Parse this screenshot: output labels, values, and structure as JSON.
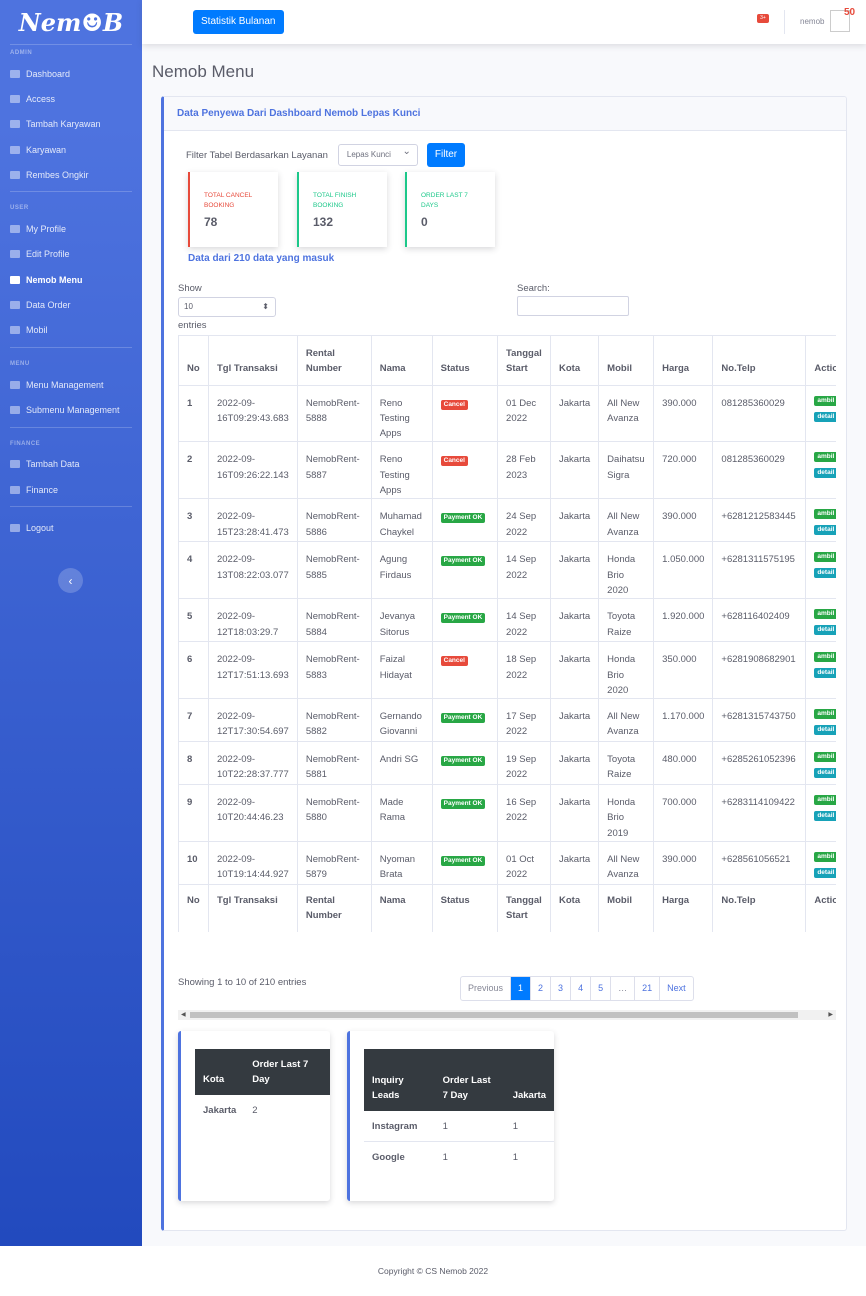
{
  "brand": "Nem☻B",
  "sidebar": {
    "sections": [
      {
        "heading": "ADMIN",
        "items": [
          {
            "label": "Dashboard",
            "icon": "dashboard-icon"
          },
          {
            "label": "Access",
            "icon": "users-icon"
          },
          {
            "label": "Tambah Karyawan",
            "icon": "user-plus-icon"
          },
          {
            "label": "Karyawan",
            "icon": "users-icon"
          },
          {
            "label": "Rembes Ongkir",
            "icon": "file-icon"
          }
        ]
      },
      {
        "heading": "USER",
        "items": [
          {
            "label": "My Profile",
            "icon": "user-icon"
          },
          {
            "label": "Edit Profile",
            "icon": "user-edit-icon"
          },
          {
            "label": "Nemob Menu",
            "icon": "sitemap-icon",
            "active": true
          },
          {
            "label": "Data Order",
            "icon": "chart-icon"
          },
          {
            "label": "Mobil",
            "icon": "car-icon"
          }
        ]
      },
      {
        "heading": "MENU",
        "items": [
          {
            "label": "Menu Management",
            "icon": "folder-icon"
          },
          {
            "label": "Submenu Management",
            "icon": "folder-open-icon"
          }
        ]
      },
      {
        "heading": "FINANCE",
        "items": [
          {
            "label": "Tambah Data",
            "icon": "file-icon"
          },
          {
            "label": "Finance",
            "icon": "money-icon"
          }
        ]
      }
    ],
    "logout": "Logout",
    "toggle": "‹"
  },
  "topbar": {
    "stat_button": "Statistik Bulanan",
    "alert_count": "3+",
    "username": "nemob",
    "badge": "50"
  },
  "page_title": "Nemob Menu",
  "card": {
    "header": "Data Penyewa Dari Dashboard Nemob Lepas Kunci",
    "filter_label": "Filter Tabel Berdasarkan Layanan",
    "filter_value": "Lepas Kunci",
    "filter_button": "Filter",
    "stats": [
      {
        "label": "TOTAL CANCEL BOOKING",
        "value": "78",
        "color": "#e74a3b"
      },
      {
        "label": "TOTAL FINISH BOOKING",
        "value": "132",
        "color": "#1cc88a"
      },
      {
        "label": "ORDER LAST 7 DAYS",
        "value": "0",
        "color": "#1cc88a"
      }
    ],
    "data_note": "Data dari 210 data yang masuk"
  },
  "table": {
    "show_label": "Show",
    "show_value": "10",
    "entries_label": "entries",
    "search_label": "Search:",
    "columns": [
      "No",
      "Tgl Transaksi",
      "Rental Number",
      "Nama",
      "Status",
      "Tanggal Start",
      "Kota",
      "Mobil",
      "Harga",
      "No.Telp",
      "Action"
    ],
    "rows": [
      {
        "no": "1",
        "tgl": "2022-09-16T09:29:43.683",
        "rental": "NemobRent-5888",
        "nama": "Reno Testing Apps",
        "status": "Cancel",
        "start": "01 Dec 2022",
        "kota": "Jakarta",
        "mobil": "All New Avanza",
        "harga": "390.000",
        "telp": "081285360029",
        "ambil": "ambil",
        "detail": "detail"
      },
      {
        "no": "2",
        "tgl": "2022-09-16T09:26:22.143",
        "rental": "NemobRent-5887",
        "nama": "Reno Testing Apps",
        "status": "Cancel",
        "start": "28 Feb 2023",
        "kota": "Jakarta",
        "mobil": "Daihatsu Sigra",
        "harga": "720.000",
        "telp": "081285360029",
        "ambil": "ambil",
        "detail": "detail"
      },
      {
        "no": "3",
        "tgl": "2022-09-15T23:28:41.473",
        "rental": "NemobRent-5886",
        "nama": "Muhamad Chaykel",
        "status": "Payment OK",
        "start": "24 Sep 2022",
        "kota": "Jakarta",
        "mobil": "All New Avanza",
        "harga": "390.000",
        "telp": "+6281212583445",
        "ambil": "ambil",
        "detail": "detail"
      },
      {
        "no": "4",
        "tgl": "2022-09-13T08:22:03.077",
        "rental": "NemobRent-5885",
        "nama": "Agung Firdaus",
        "status": "Payment OK",
        "start": "14 Sep 2022",
        "kota": "Jakarta",
        "mobil": "Honda Brio 2020",
        "harga": "1.050.000",
        "telp": "+6281311575195",
        "ambil": "ambil",
        "detail": "detail"
      },
      {
        "no": "5",
        "tgl": "2022-09-12T18:03:29.7",
        "rental": "NemobRent-5884",
        "nama": "Jevanya Sitorus",
        "status": "Payment OK",
        "start": "14 Sep 2022",
        "kota": "Jakarta",
        "mobil": "Toyota Raize",
        "harga": "1.920.000",
        "telp": "+628116402409",
        "ambil": "ambil",
        "detail": "detail"
      },
      {
        "no": "6",
        "tgl": "2022-09-12T17:51:13.693",
        "rental": "NemobRent-5883",
        "nama": "Faizal Hidayat",
        "status": "Cancel",
        "start": "18 Sep 2022",
        "kota": "Jakarta",
        "mobil": "Honda Brio 2020",
        "harga": "350.000",
        "telp": "+6281908682901",
        "ambil": "ambil",
        "detail": "detail"
      },
      {
        "no": "7",
        "tgl": "2022-09-12T17:30:54.697",
        "rental": "NemobRent-5882",
        "nama": "Gernando Giovanni",
        "status": "Payment OK",
        "start": "17 Sep 2022",
        "kota": "Jakarta",
        "mobil": "All New Avanza",
        "harga": "1.170.000",
        "telp": "+6281315743750",
        "ambil": "ambil",
        "detail": "detail"
      },
      {
        "no": "8",
        "tgl": "2022-09-10T22:28:37.777",
        "rental": "NemobRent-5881",
        "nama": "Andri SG",
        "status": "Payment OK",
        "start": "19 Sep 2022",
        "kota": "Jakarta",
        "mobil": "Toyota Raize",
        "harga": "480.000",
        "telp": "+6285261052396",
        "ambil": "ambil",
        "detail": "detail"
      },
      {
        "no": "9",
        "tgl": "2022-09-10T20:44:46.23",
        "rental": "NemobRent-5880",
        "nama": "Made Rama",
        "status": "Payment OK",
        "start": "16 Sep 2022",
        "kota": "Jakarta",
        "mobil": "Honda Brio 2019",
        "harga": "700.000",
        "telp": "+6283114109422",
        "ambil": "ambil",
        "detail": "detail"
      },
      {
        "no": "10",
        "tgl": "2022-09-10T19:14:44.927",
        "rental": "NemobRent-5879",
        "nama": "Nyoman Brata",
        "status": "Payment OK",
        "start": "01 Oct 2022",
        "kota": "Jakarta",
        "mobil": "All New Avanza",
        "harga": "390.000",
        "telp": "+628561056521",
        "ambil": "ambil",
        "detail": "detail"
      }
    ],
    "info": "Showing 1 to 10 of 210 entries",
    "pagination": [
      "Previous",
      "1",
      "2",
      "3",
      "4",
      "5",
      "…",
      "21",
      "Next"
    ],
    "current_page": "1"
  },
  "kota_table": {
    "columns": [
      "Kota",
      "Order Last 7 Day"
    ],
    "rows": [
      [
        "Jakarta",
        "2"
      ]
    ]
  },
  "leads_table": {
    "columns": [
      "Inquiry Leads",
      "Order Last 7 Day",
      "Jakarta"
    ],
    "rows": [
      [
        "Instagram",
        "1",
        "1"
      ],
      [
        "Google",
        "1",
        "1"
      ]
    ]
  },
  "footer": "Copyright © CS Nemob 2022"
}
